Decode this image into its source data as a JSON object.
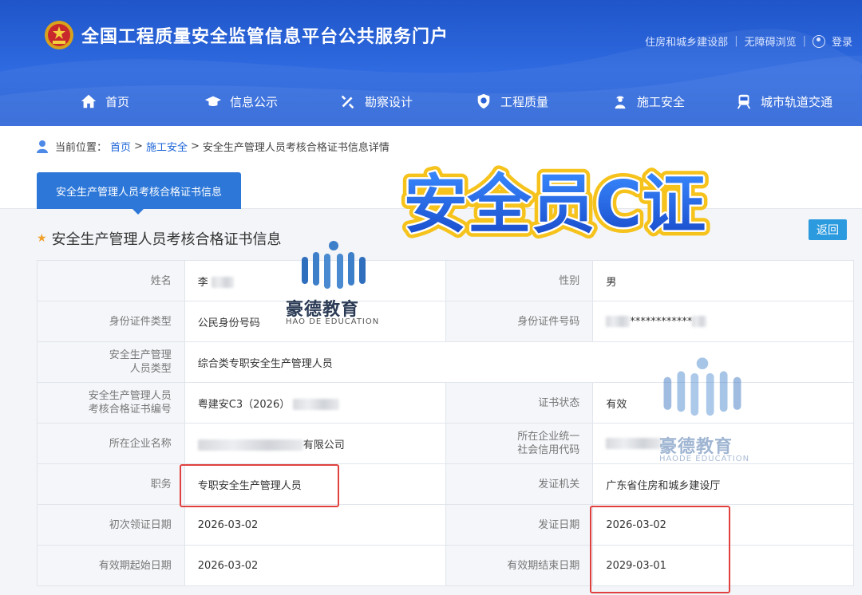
{
  "header": {
    "site_title": "全国工程质量安全监管信息平台公共服务门户",
    "links": [
      "住房和城乡建设部",
      "无障碍浏览"
    ],
    "login_label": "登录"
  },
  "nav": {
    "items": [
      {
        "label": "首页",
        "icon": "home-icon"
      },
      {
        "label": "信息公示",
        "icon": "mortarboard-icon"
      },
      {
        "label": "勘察设计",
        "icon": "tools-icon"
      },
      {
        "label": "工程质量",
        "icon": "shield-check-icon"
      },
      {
        "label": "施工安全",
        "icon": "worker-icon"
      },
      {
        "label": "城市轨道交通",
        "icon": "train-icon"
      }
    ]
  },
  "breadcrumb": {
    "prefix": "当前位置：",
    "home": "首页",
    "sep": ">",
    "section": "施工安全",
    "current": "安全生产管理人员考核合格证书信息详情"
  },
  "tab": {
    "label": "安全生产管理人员考核合格证书信息"
  },
  "section": {
    "title": "安全生产管理人员考核合格证书信息",
    "back_label": "返回"
  },
  "table": {
    "name_label": "姓名",
    "name_value": "李",
    "gender_label": "性别",
    "gender_value": "男",
    "id_type_label": "身份证件类型",
    "id_type_value": "公民身份号码",
    "id_no_label": "身份证件号码",
    "id_no_value": "************",
    "staff_type_label_1": "安全生产管理",
    "staff_type_label_2": "人员类型",
    "staff_type_value": "综合类专职安全生产管理人员",
    "cert_no_label_1": "安全生产管理人员",
    "cert_no_label_2": "考核合格证书编号",
    "cert_no_value": "粤建安C3（2026）",
    "cert_status_label": "证书状态",
    "cert_status_value": "有效",
    "company_label": "所在企业名称",
    "company_value": "有限公司",
    "credit_label_1": "所在企业统一",
    "credit_label_2": "社会信用代码",
    "position_label": "职务",
    "position_value": "专职安全生产管理人员",
    "issuer_label": "发证机关",
    "issuer_value": "广东省住房和城乡建设厅",
    "first_date_label": "初次领证日期",
    "first_date_value": "2026-03-02",
    "issue_date_label": "发证日期",
    "issue_date_value": "2026-03-02",
    "valid_start_label": "有效期起始日期",
    "valid_start_value": "2026-03-02",
    "valid_end_label": "有效期结束日期",
    "valid_end_value": "2029-03-01"
  },
  "overlay": {
    "banner_text": "安全员C证",
    "watermark_cn_1": "豪德教育",
    "watermark_en_1": "HAO DE EDUCATION",
    "watermark_cn_2": "豪德教育",
    "watermark_en_2": "HAODE EDUCATION"
  },
  "colors": {
    "header_blue": "#2a63d8",
    "tab_blue": "#2c77d8",
    "highlight_red": "#e0413f",
    "star_orange": "#f0a02b"
  }
}
